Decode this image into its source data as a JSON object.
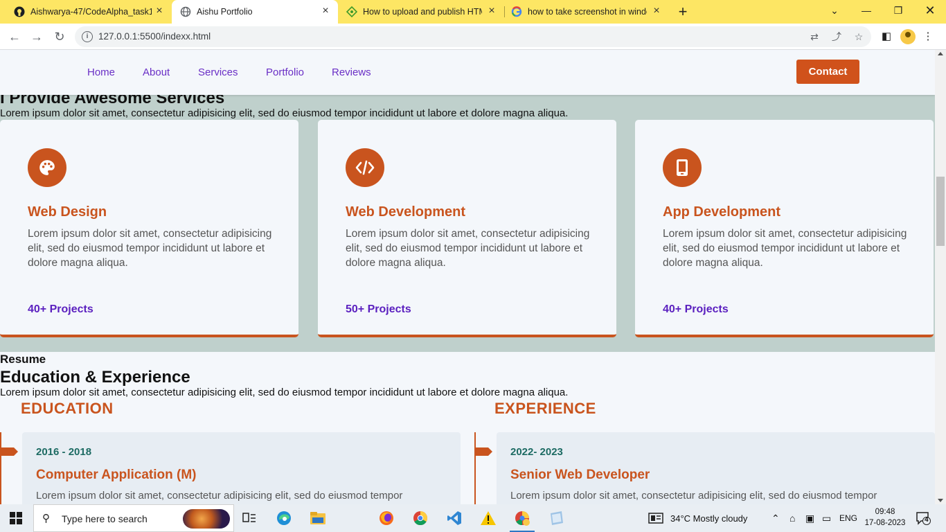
{
  "browser": {
    "tabs": [
      {
        "title": "Aishwarya-47/CodeAlpha_task1",
        "icon": "github-icon",
        "active": false
      },
      {
        "title": "Aishu Portfolio",
        "icon": "globe-icon",
        "active": true
      },
      {
        "title": "How to upload and publish HTML",
        "icon": "codepen-icon",
        "active": false
      },
      {
        "title": "how to take screenshot in windo",
        "icon": "google-icon",
        "active": false
      }
    ],
    "url": "127.0.0.1:5500/indexx.html"
  },
  "header": {
    "nav": [
      "Home",
      "About",
      "Services",
      "Portfolio",
      "Reviews"
    ],
    "contact": "Contact"
  },
  "services": {
    "heading": "I Provide Awesome Services",
    "subtitle": "Lorem ipsum dolor sit amet, consectetur adipisicing elit, sed do eiusmod tempor incididunt ut labore et dolore magna aliqua.",
    "cards": [
      {
        "icon": "palette-icon",
        "title": "Web Design",
        "description": "Lorem ipsum dolor sit amet, consectetur adipisicing elit, sed do eiusmod tempor incididunt ut labore et dolore magna aliqua.",
        "projects": "40+ Projects"
      },
      {
        "icon": "code-icon",
        "title": "Web Development",
        "description": "Lorem ipsum dolor sit amet, consectetur adipisicing elit, sed do eiusmod tempor incididunt ut labore et dolore magna aliqua.",
        "projects": "50+ Projects"
      },
      {
        "icon": "mobile-icon",
        "title": "App Development",
        "description": "Lorem ipsum dolor sit amet, consectetur adipisicing elit, sed do eiusmod tempor incididunt ut labore et dolore magna aliqua.",
        "projects": "40+ Projects"
      }
    ]
  },
  "resume": {
    "label": "Resume",
    "heading": "Education & Experience",
    "subtitle": "Lorem ipsum dolor sit amet, consectetur adipisicing elit, sed do eiusmod tempor incididunt ut labore et dolore magna aliqua.",
    "education": {
      "title": "EDUCATION",
      "years": "2016 - 2018",
      "role": "Computer Application (M)",
      "description": "Lorem ipsum dolor sit amet, consectetur adipisicing elit, sed do eiusmod tempor"
    },
    "experience": {
      "title": "EXPERIENCE",
      "years": "2022- 2023",
      "role": "Senior Web Developer",
      "description": "Lorem ipsum dolor sit amet, consectetur adipisicing elit, sed do eiusmod tempor"
    }
  },
  "taskbar": {
    "search_placeholder": "Type here to search",
    "weather": "34°C  Mostly cloudy",
    "language": "ENG",
    "time": "09:48",
    "date": "17-08-2023",
    "notifications": "4"
  },
  "colors": {
    "accent": "#c9541e",
    "nav_link": "#6a2fc6",
    "tab_strip": "#fde664",
    "services_bg": "#bfd0cc"
  }
}
